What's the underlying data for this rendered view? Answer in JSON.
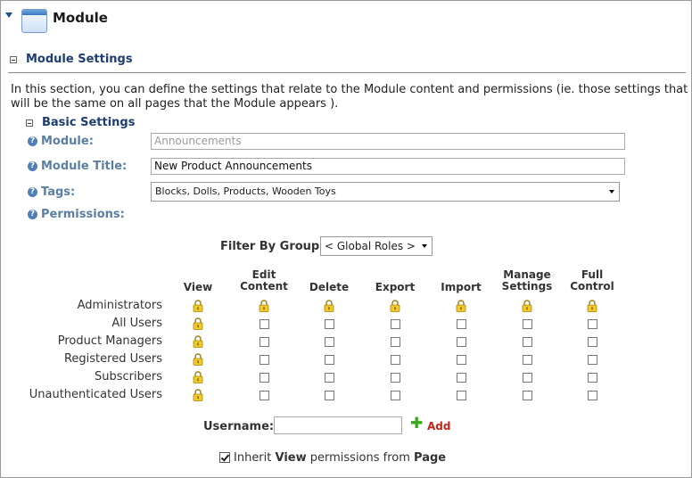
{
  "header": {
    "title": "Module"
  },
  "module_settings": {
    "title": "Module Settings",
    "intro": "In this section, you can define the settings that relate to the Module content and permissions (ie. those settings that will be the same on all pages that the Module appears )."
  },
  "basic_settings": {
    "title": "Basic Settings",
    "module_label": "Module:",
    "module_value": "Announcements",
    "module_title_label": "Module Title:",
    "module_title_value": "New Product Announcements",
    "tags_label": "Tags:",
    "tags_value": "Blocks, Dolls, Products, Wooden Toys",
    "permissions_label": "Permissions:"
  },
  "permissions": {
    "filter_label": "Filter By Group:",
    "filter_value": "< Global Roles >",
    "columns": [
      [
        "View"
      ],
      [
        "Edit",
        "Content"
      ],
      [
        "Delete"
      ],
      [
        "Export"
      ],
      [
        "Import"
      ],
      [
        "Manage",
        "Settings"
      ],
      [
        "Full",
        "Control"
      ]
    ],
    "roles": [
      "Administrators",
      "All Users",
      "Product Managers",
      "Registered Users",
      "Subscribers",
      "Unauthenticated Users"
    ],
    "username_label": "Username:",
    "username_value": "",
    "add_label": "Add",
    "inherit_prefix": "Inherit ",
    "inherit_bold1": "View",
    "inherit_middle": " permissions from ",
    "inherit_bold2": "Page",
    "inherit_checked": true
  },
  "icons": {
    "collapse": "triangle-down-icon",
    "module": "window-icon",
    "section_toggle": "minus-box-icon",
    "help": "help-circle-icon",
    "lock": "padlock-icon",
    "add": "plus-icon"
  },
  "colors": {
    "section_title": "#1e3d73",
    "field_label": "#5b7fa4",
    "add_link": "#c0261c",
    "add_icon": "#38a81b",
    "lock": "#e8c21e"
  }
}
